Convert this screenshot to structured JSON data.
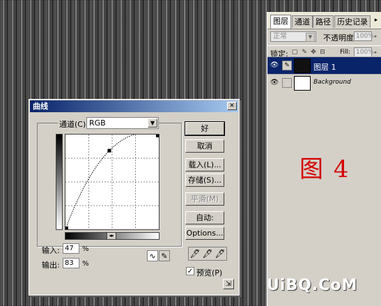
{
  "layers_panel": {
    "tabs": [
      "图层",
      "通道",
      "路径",
      "历史记录"
    ],
    "blend_mode": "正常",
    "opacity_label": "不透明度:",
    "opacity_value": "100%",
    "lock_label": "锁定:",
    "fill_label": "Fill:",
    "fill_value": "100%",
    "layers": [
      {
        "name": "图层 1",
        "thumb_color": "#111111",
        "selected": true
      },
      {
        "name": "Background",
        "thumb_color": "#ffffff",
        "selected": false
      }
    ],
    "annotation": "图 4"
  },
  "curves_dialog": {
    "title": "曲线",
    "channel_label": "通道(C):",
    "channel_value": "RGB",
    "input_label": "输入:",
    "input_value": "47",
    "output_label": "输出:",
    "output_value": "83",
    "percent": "%",
    "buttons": {
      "ok": "好",
      "cancel": "取消",
      "load": "载入(L)...",
      "save": "存储(S)...",
      "smooth": "平滑(M)",
      "auto": "自动:",
      "options": "Options..."
    },
    "preview_label": "预览(P)",
    "preview_checked": true,
    "curve_point": {
      "input": 47,
      "output": 83
    }
  },
  "watermark": "UiBQ.CoM"
}
